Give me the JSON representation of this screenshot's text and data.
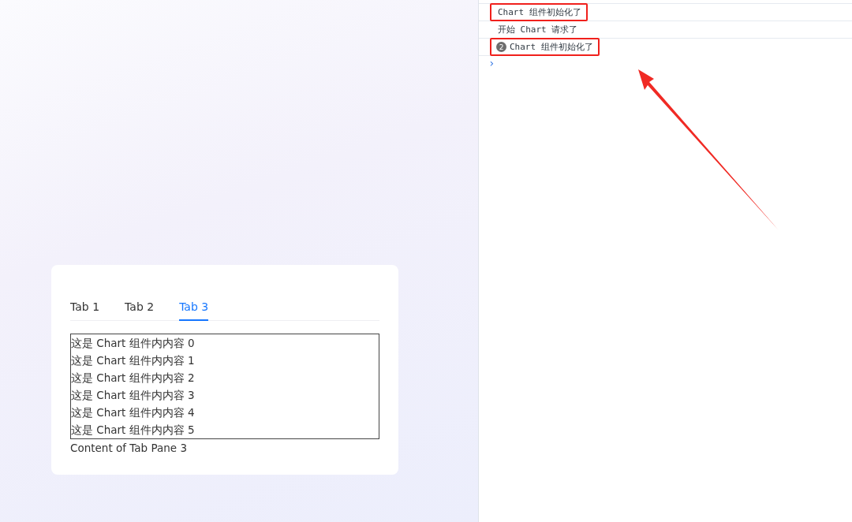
{
  "tabs": [
    {
      "label": "Tab 1",
      "selected": false
    },
    {
      "label": "Tab 2",
      "selected": false
    },
    {
      "label": "Tab 3",
      "selected": true
    }
  ],
  "chart_lines": [
    "这是 Chart 组件内内容 0",
    "这是 Chart 组件内内容 1",
    "这是 Chart 组件内内容 2",
    "这是 Chart 组件内内容 3",
    "这是 Chart 组件内内容 4",
    "这是 Chart 组件内内容 5"
  ],
  "pane_text": "Content of Tab Pane 3",
  "console": {
    "messages": [
      {
        "text": "Chart 组件初始化了",
        "highlighted": true
      },
      {
        "text": "开始 Chart 请求了",
        "highlighted": false
      },
      {
        "text": "Chart 组件初始化了",
        "count": "2",
        "highlighted": true
      }
    ],
    "prompt": "›"
  }
}
